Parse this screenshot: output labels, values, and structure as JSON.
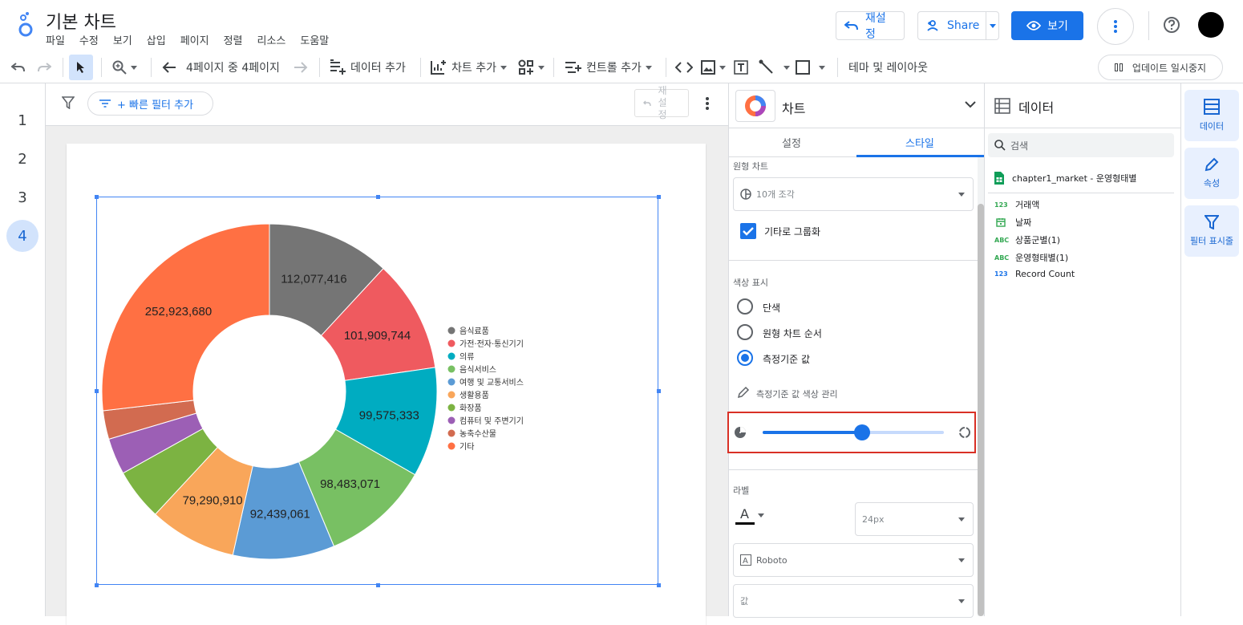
{
  "app": {
    "title": "기본 차트",
    "menu": [
      "파일",
      "수정",
      "보기",
      "삽입",
      "페이지",
      "정렬",
      "리소스",
      "도움말"
    ],
    "reset_label": "재설정",
    "share_label": "Share",
    "view_label": "보기"
  },
  "toolbar": {
    "page_indicator": "4페이지 중 4페이지",
    "add_data": "데이터 추가",
    "add_chart": "차트 추가",
    "add_control": "컨트롤 추가",
    "theme_layout": "테마 및 레이아웃",
    "pause_updates": "업데이트 일시중지"
  },
  "pages": [
    "1",
    "2",
    "3",
    "4"
  ],
  "active_page": "4",
  "canvas": {
    "quick_filter": "+ 빠른 필터 추가",
    "reset_disabled": "재설정"
  },
  "chart_data": {
    "type": "pie",
    "donut": true,
    "categories": [
      "음식료품",
      "가전·전자·통신기기",
      "의류",
      "음식서비스",
      "여행 및 교통서비스",
      "생활용품",
      "화장품",
      "컴퓨터 및 주변기기",
      "농축수산물",
      "기타"
    ],
    "values": [
      112077416,
      101909744,
      99575333,
      98483071,
      92439061,
      79290910,
      47000000,
      33000000,
      26000000,
      252923680
    ],
    "data_labels": [
      "112,077,416",
      "101,909,744",
      "99,575,333",
      "98,483,071",
      "92,439,061",
      "79,290,910",
      "",
      "",
      "",
      "252,923,680"
    ],
    "colors": [
      "#757575",
      "#ef5a5f",
      "#00acc1",
      "#78c063",
      "#5b9bd5",
      "#f9a65a",
      "#7cb342",
      "#9c5fb5",
      "#d26b50",
      "#ff7043"
    ],
    "legend_position": "right"
  },
  "props": {
    "panel_title": "차트",
    "tab_setup": "설정",
    "tab_style": "스타일",
    "pie_section": "원형 차트",
    "slices_value": "10개 조각",
    "group_other_label": "기타로 그룹화",
    "group_other_checked": true,
    "color_section": "색상 표시",
    "radio_options": [
      "단색",
      "원형 차트 순서",
      "측정기준 값"
    ],
    "radio_selected": 2,
    "manage_colors": "측정기준 값 색상 관리",
    "donut_hole_fraction": 0.55,
    "label_section": "라벨",
    "font_size": "24px",
    "font_family": "Roboto",
    "label_type": "값"
  },
  "datapanel": {
    "title": "데이터",
    "search_placeholder": "검색",
    "source": "chapter1_market - 운영형태별",
    "fields": [
      {
        "type": "123",
        "name": "거래액",
        "color": "#34a853"
      },
      {
        "type": "date",
        "name": "날짜",
        "color": "#34a853"
      },
      {
        "type": "ABC",
        "name": "상품군별(1)",
        "color": "#34a853"
      },
      {
        "type": "ABC",
        "name": "운영형태별(1)",
        "color": "#34a853"
      },
      {
        "type": "123",
        "name": "Record Count",
        "color": "#1a73e8"
      }
    ]
  },
  "rail": {
    "data": "데이터",
    "properties": "속성",
    "filters": "필터 표시줄"
  }
}
